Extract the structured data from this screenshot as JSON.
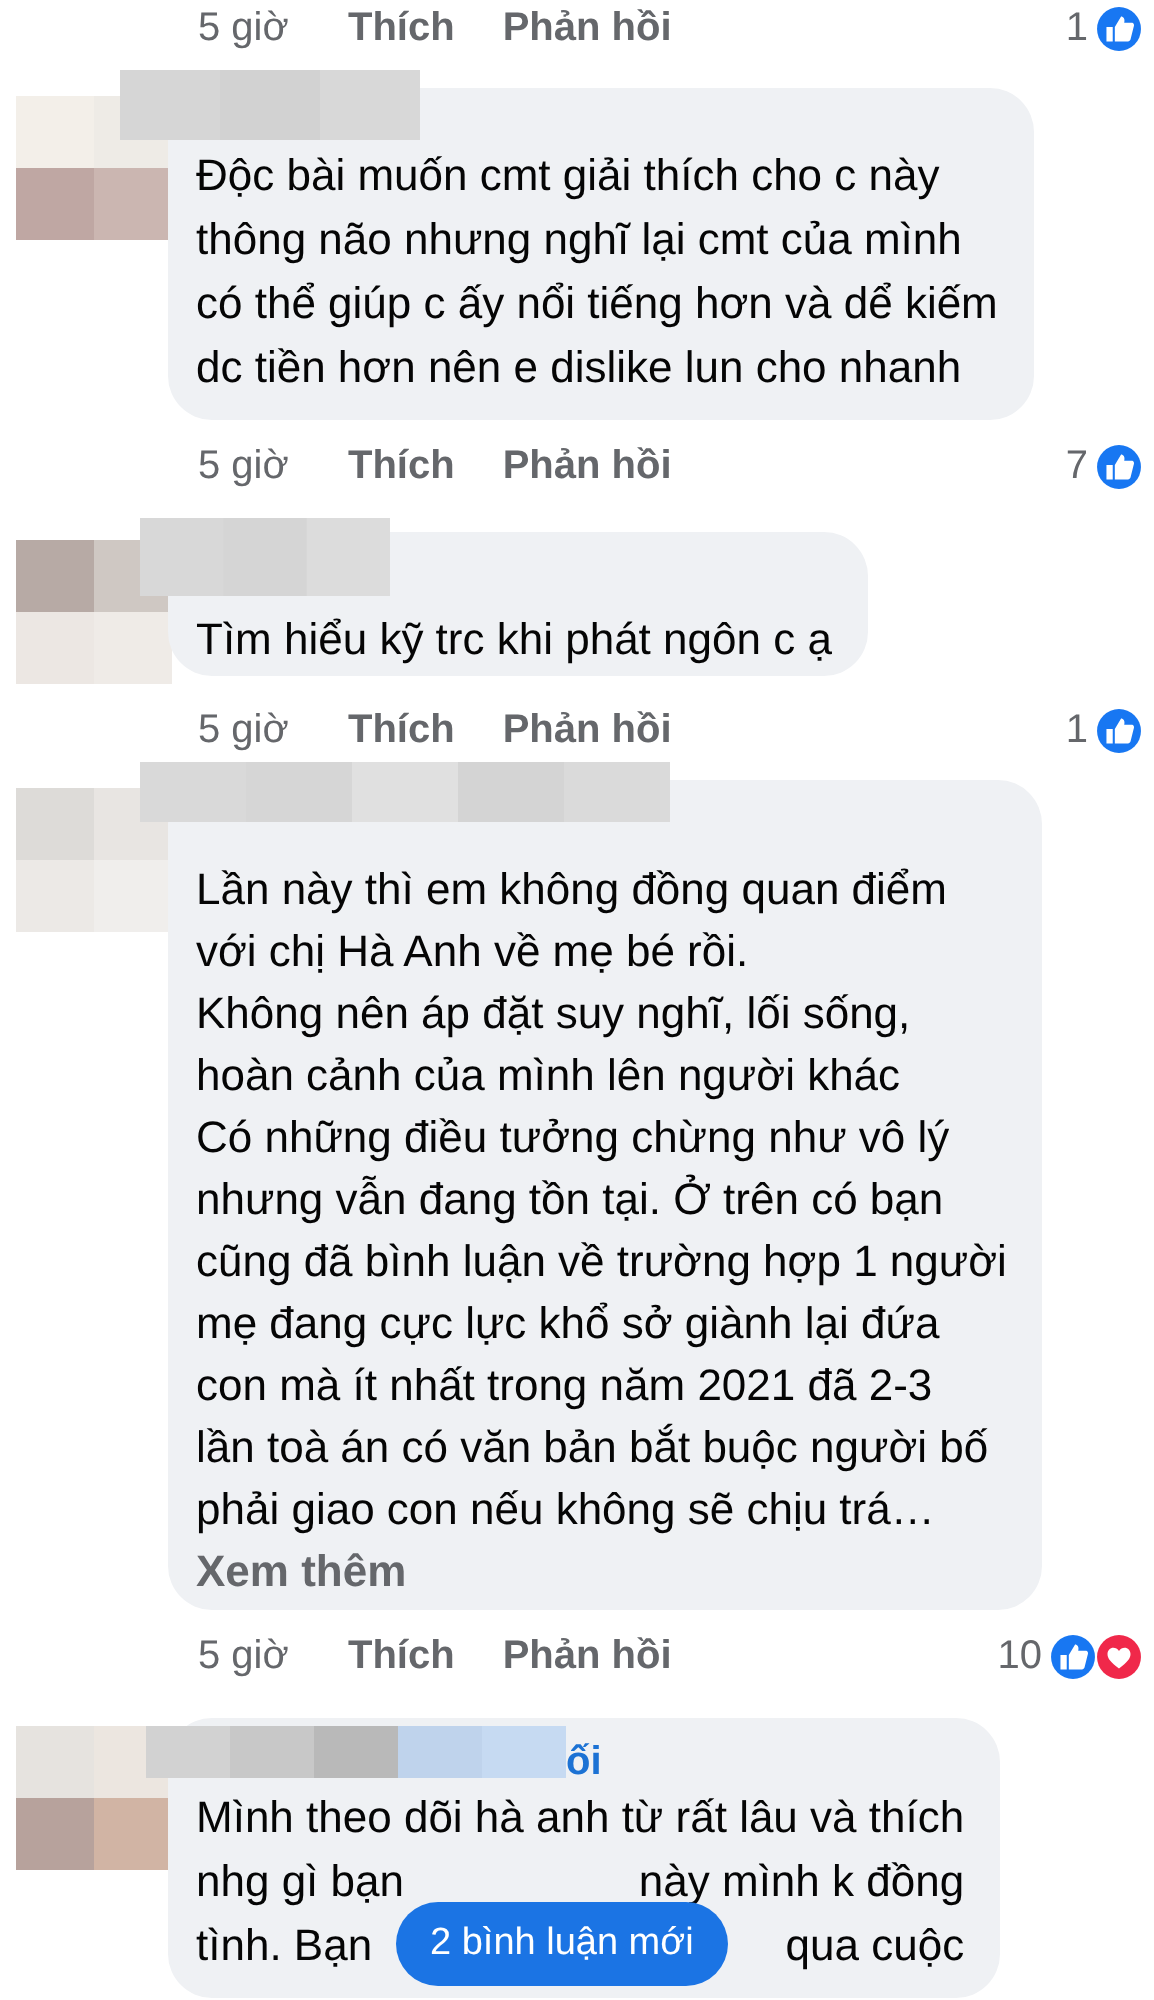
{
  "items": [
    {
      "kind": "actions",
      "time": "5 giờ",
      "like": "Thích",
      "reply": "Phản hồi",
      "count": "1",
      "reactions": [
        {
          "kind": "like"
        }
      ]
    },
    {
      "kind": "comment",
      "lines": [
        [
          "Độc bài muốn cmt giải thích cho c này"
        ],
        [
          "thông não nhưng nghĩ lại cmt của mình"
        ],
        [
          "có thể giúp c ấy nổi tiếng hơn và dể kiếm"
        ],
        [
          "dc tiền hơn nên e dislike lun cho nhanh"
        ]
      ]
    },
    {
      "kind": "actions",
      "time": "5 giờ",
      "like": "Thích",
      "reply": "Phản hồi",
      "count": "7",
      "reactions": [
        {
          "kind": "like"
        }
      ]
    },
    {
      "kind": "comment",
      "lines": [
        [
          "Tìm hiểu kỹ trc khi phát ngôn c ạ"
        ]
      ]
    },
    {
      "kind": "actions",
      "time": "5 giờ",
      "like": "Thích",
      "reply": "Phản hồi",
      "count": "1",
      "reactions": [
        {
          "kind": "like"
        }
      ]
    },
    {
      "kind": "comment",
      "lines": [
        [
          "Lần này thì em không đồng quan điểm"
        ],
        [
          "với chị Hà Anh về mẹ bé rồi."
        ],
        [
          "Không nên áp đặt suy nghĩ, lối sống,"
        ],
        [
          "hoàn cảnh của mình lên người khác"
        ],
        [
          "Có những điều tưởng chừng như vô lý"
        ],
        [
          "nhưng vẫn đang tồn tại. Ở trên có bạn"
        ],
        [
          "cũng đã bình luận về trường hợp 1 người"
        ],
        [
          "mẹ đang cực lực khổ sở giành lại đứa"
        ],
        [
          "con mà ít nhất trong năm 2021 đã 2-3"
        ],
        [
          "lần toà án có văn bản bắt buộc người bố"
        ],
        [
          "phải giao con nếu không sẽ chịu trá…"
        ]
      ],
      "more": "Xem thêm"
    },
    {
      "kind": "actions",
      "time": "5 giờ",
      "like": "Thích",
      "reply": "Phản hồi",
      "count": "10",
      "reactions": [
        {
          "kind": "like"
        },
        {
          "kind": "love"
        }
      ]
    },
    {
      "kind": "comment",
      "name_fragment": "ối",
      "lines": [
        [
          "Mình theo dõi hà anh từ rất lâu và thích"
        ],
        [
          "nhg gì bạn",
          "này mình k đồng"
        ],
        [
          "tình. Bạn",
          "qua cuộc"
        ]
      ]
    }
  ],
  "new_comments_button": "2 bình luận mới"
}
